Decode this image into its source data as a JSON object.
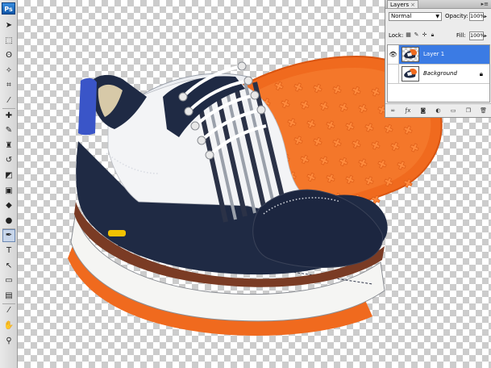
{
  "app": {
    "logo": "Ps"
  },
  "toolbar": {
    "tools": [
      {
        "name": "move-tool-icon",
        "glyph": "➤"
      },
      {
        "name": "marquee-tool-icon",
        "glyph": "⬚"
      },
      {
        "name": "lasso-tool-icon",
        "glyph": "ʘ"
      },
      {
        "name": "magic-wand-tool-icon",
        "glyph": "✧"
      },
      {
        "name": "crop-tool-icon",
        "glyph": "⌗"
      },
      {
        "name": "eyedropper-tool-icon",
        "glyph": "⁄"
      },
      {
        "name": "healing-brush-tool-icon",
        "glyph": "✚"
      },
      {
        "name": "brush-tool-icon",
        "glyph": "✎"
      },
      {
        "name": "clone-stamp-tool-icon",
        "glyph": "♜"
      },
      {
        "name": "history-brush-tool-icon",
        "glyph": "↺"
      },
      {
        "name": "eraser-tool-icon",
        "glyph": "◩"
      },
      {
        "name": "gradient-tool-icon",
        "glyph": "▣"
      },
      {
        "name": "blur-tool-icon",
        "glyph": "◆"
      },
      {
        "name": "dodge-tool-icon",
        "glyph": "●"
      },
      {
        "name": "pen-tool-icon",
        "glyph": "✒",
        "active": true
      },
      {
        "name": "type-tool-icon",
        "glyph": "T"
      },
      {
        "name": "path-selection-tool-icon",
        "glyph": "↖"
      },
      {
        "name": "shape-tool-icon",
        "glyph": "▭"
      },
      {
        "name": "notes-tool-icon",
        "glyph": "▤"
      },
      {
        "name": "eyedropper2-tool-icon",
        "glyph": "⁄"
      },
      {
        "name": "hand-tool-icon",
        "glyph": "✋"
      },
      {
        "name": "zoom-tool-icon",
        "glyph": "⚲"
      }
    ]
  },
  "layers_panel": {
    "tab_label": "Layers",
    "tab_close": "×",
    "blend_mode": "Normal",
    "opacity_label": "Opacity:",
    "opacity_value": "100%",
    "lock_label": "Lock:",
    "fill_label": "Fill:",
    "fill_value": "100%",
    "layers": [
      {
        "name": "Layer 1",
        "selected": true,
        "visible": true
      },
      {
        "name": "Background",
        "selected": false,
        "visible": false,
        "locked": true
      }
    ]
  },
  "colors": {
    "shoe_navy": "#1f2a44",
    "shoe_white": "#f3f4f6",
    "sole_orange": "#f06a1e",
    "heel_blue": "#3a55c8",
    "selection_blue": "#3b7be4"
  }
}
